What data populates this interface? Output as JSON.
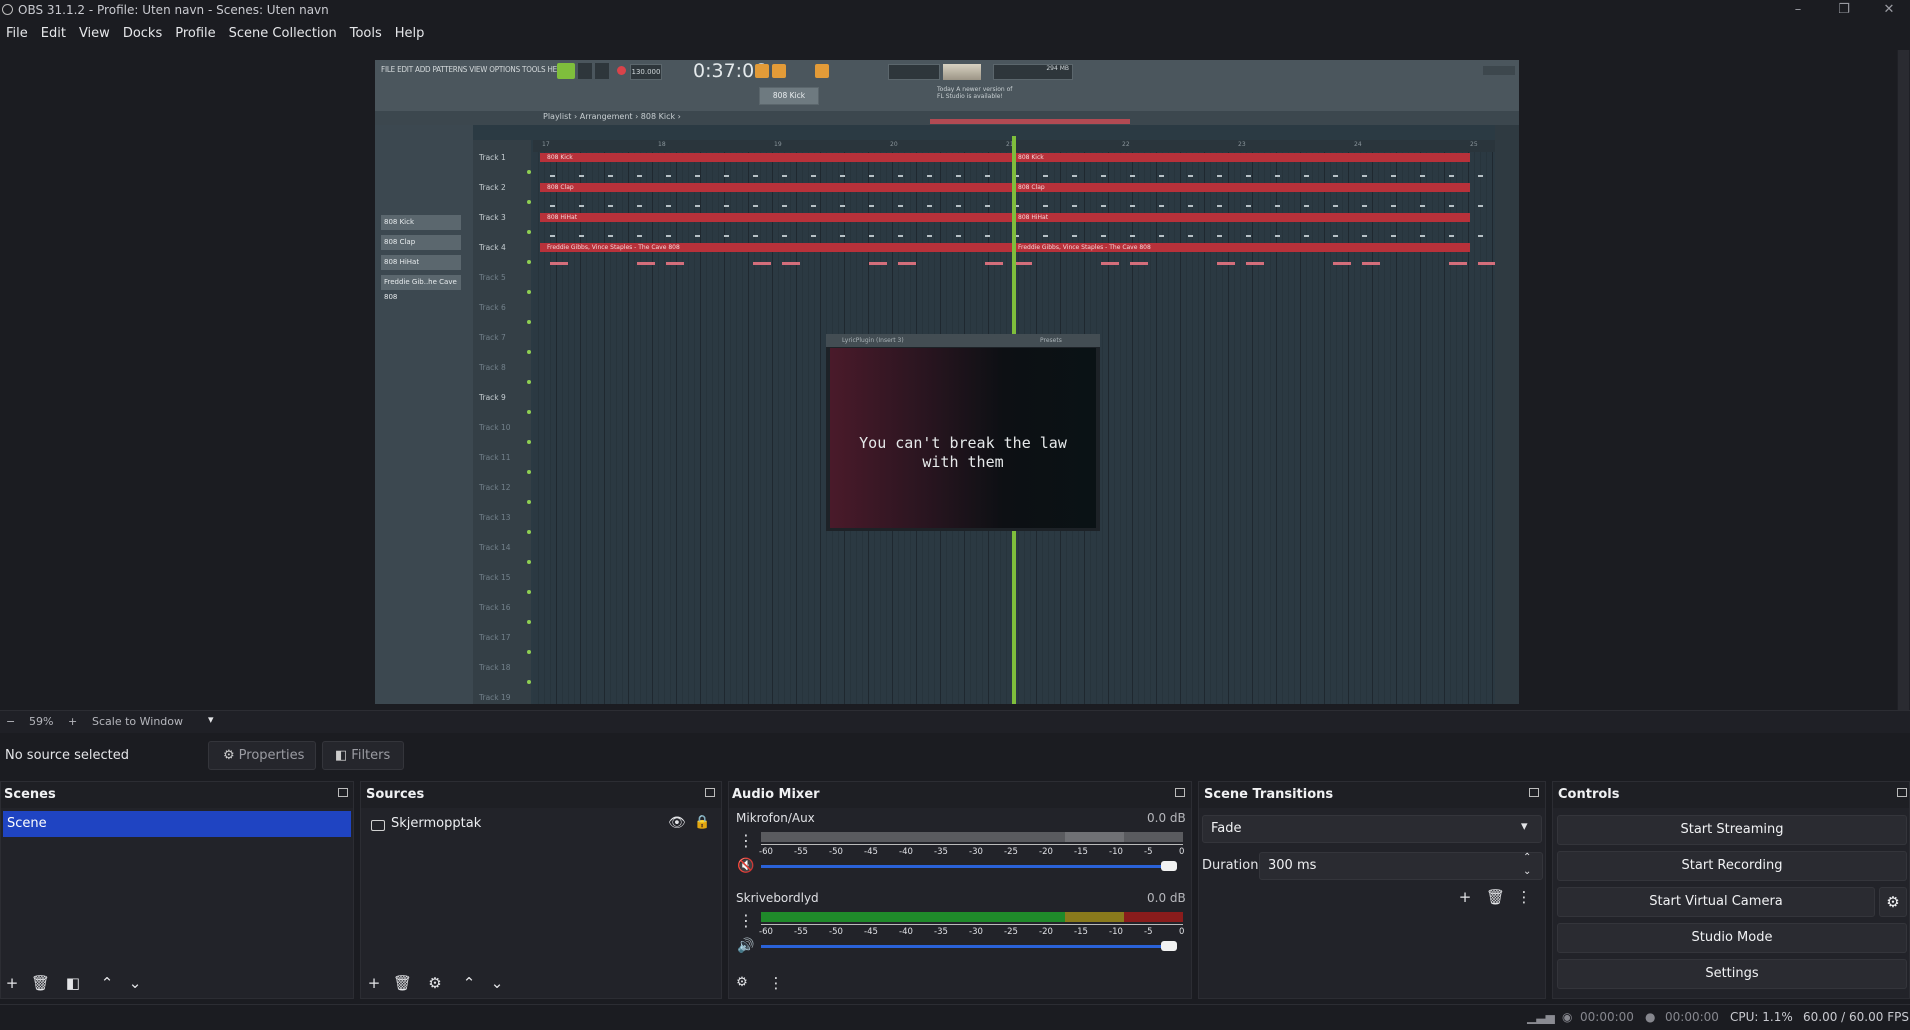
{
  "window": {
    "title": "OBS 31.1.2 - Profile: Uten navn - Scenes: Uten navn",
    "minimize": "–",
    "maximize": "❐",
    "close": "✕"
  },
  "menu": [
    "File",
    "Edit",
    "View",
    "Docks",
    "Profile",
    "Scene Collection",
    "Tools",
    "Help"
  ],
  "preview": {
    "fl_menu": "FILE EDIT ADD PATTERNS VIEW OPTIONS TOOLS HELP",
    "fl_time": "0:37:06",
    "fl_tempo": "130.000",
    "fl_pattern": "808 Kick",
    "fl_breadcrumb": "Playlist › Arrangement › 808 Kick ›",
    "fl_news": "Today  A newer version of FL Studio is available!",
    "fl_mem": "294 MB",
    "patterns": [
      "808 Kick",
      "808 Clap",
      "808 HiHat",
      "Freddie Gib..he Cave 808"
    ],
    "tracks": [
      "Track 1",
      "Track 2",
      "Track 3",
      "Track 4",
      "Track 5",
      "Track 6",
      "Track 7",
      "Track 8",
      "Track 9",
      "Track 10",
      "Track 11",
      "Track 12",
      "Track 13",
      "Track 14",
      "Track 15",
      "Track 16",
      "Track 17",
      "Track 18",
      "Track 19"
    ],
    "clip_labels": [
      "808 Kick",
      "808 Clap",
      "808 HiHat",
      "Freddie Gibbs, Vince Staples - The Cave 808"
    ],
    "ruler_numbers": [
      "17",
      "18",
      "19",
      "20",
      "21",
      "22",
      "23",
      "24",
      "25"
    ],
    "lyric_window_title": "LyricPlugin (Insert 3)",
    "lyric_presets": "Presets",
    "lyric_line1": "You can't break the law",
    "lyric_line2": "with them"
  },
  "zoom": {
    "minus": "−",
    "value": "59%",
    "plus": "+",
    "mode": "Scale to Window"
  },
  "context": {
    "no_source": "No source selected",
    "properties": "Properties",
    "filters": "Filters"
  },
  "scenes": {
    "title": "Scenes",
    "items": [
      "Scene"
    ]
  },
  "sources": {
    "title": "Sources",
    "items": [
      "Skjermopptak"
    ]
  },
  "audio": {
    "title": "Audio Mixer",
    "scale": [
      "-60",
      "-55",
      "-50",
      "-45",
      "-40",
      "-35",
      "-30",
      "-25",
      "-20",
      "-15",
      "-10",
      "-5",
      "0"
    ],
    "channels": [
      {
        "name": "Mikrofon/Aux",
        "db": "0.0 dB",
        "volume": 1.0,
        "muted": true
      },
      {
        "name": "Skrivebordlyd",
        "db": "0.0 dB",
        "volume": 1.0,
        "muted": false
      }
    ]
  },
  "transitions": {
    "title": "Scene Transitions",
    "selected": "Fade",
    "duration_label": "Duration",
    "duration_value": "300 ms"
  },
  "controls": {
    "title": "Controls",
    "start_streaming": "Start Streaming",
    "start_recording": "Start Recording",
    "start_virtual_camera": "Start Virtual Camera",
    "studio_mode": "Studio Mode",
    "settings": "Settings"
  },
  "status": {
    "stream_time": "00:00:00",
    "rec_time": "00:00:00",
    "cpu": "CPU: 1.1%",
    "fps": "60.00 / 60.00 FPS"
  },
  "colors": {
    "accent": "#1f44c2",
    "slider": "#2a62d8",
    "meter_green": "#1f8a2a",
    "meter_yellow": "#8a7a1c",
    "meter_red": "#8a1c1c",
    "playhead": "#7fbe3c"
  }
}
